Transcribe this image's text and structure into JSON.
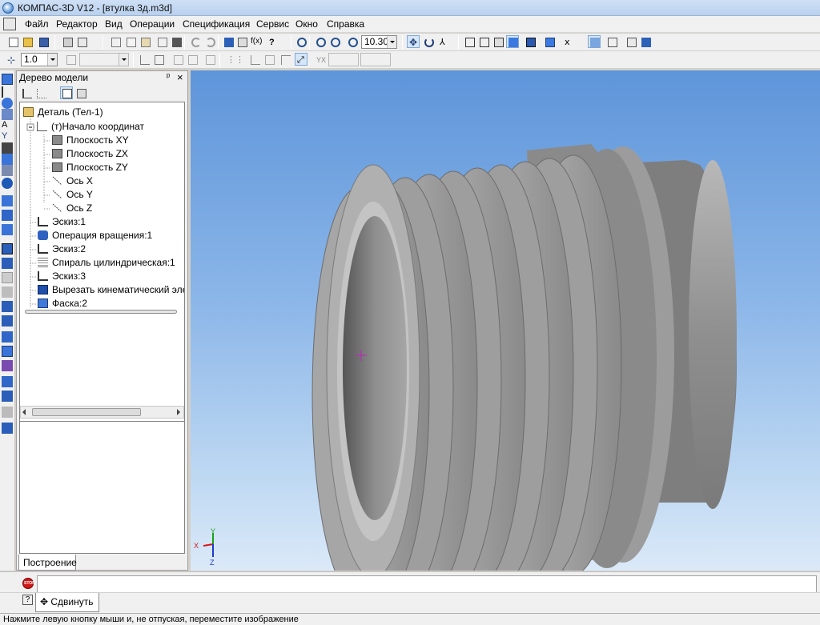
{
  "window": {
    "title": "КОМПАС-3D V12 - [втулка 3д.m3d]"
  },
  "menu": [
    "Файл",
    "Редактор",
    "Вид",
    "Операции",
    "Спецификация",
    "Сервис",
    "Окно",
    "Справка"
  ],
  "toolbar": {
    "zoom_value": "10.30",
    "line_step_value": "1.0"
  },
  "tree": {
    "title": "Дерево модели",
    "pin": "ᵖ",
    "close": "×",
    "items": [
      {
        "label": "Деталь (Тел-1)",
        "icon": "part-icon"
      },
      {
        "label": "(т)Начало координат",
        "icon": "origin-icon"
      },
      {
        "label": "Плоскость XY",
        "icon": "plane-icon"
      },
      {
        "label": "Плоскость ZX",
        "icon": "plane-icon"
      },
      {
        "label": "Плоскость ZY",
        "icon": "plane-icon"
      },
      {
        "label": "Ось X",
        "icon": "axis-icon"
      },
      {
        "label": "Ось Y",
        "icon": "axis-icon"
      },
      {
        "label": "Ось Z",
        "icon": "axis-icon"
      },
      {
        "label": "Эскиз:1",
        "icon": "sketch-icon"
      },
      {
        "label": "Операция вращения:1",
        "icon": "revolve-icon"
      },
      {
        "label": "Эскиз:2",
        "icon": "sketch-icon"
      },
      {
        "label": "Спираль цилиндрическая:1",
        "icon": "helix-icon"
      },
      {
        "label": "Эскиз:3",
        "icon": "sketch-icon"
      },
      {
        "label": "Вырезать кинематический эле",
        "icon": "sweep-cut-icon"
      },
      {
        "label": "Фаска:2",
        "icon": "chamfer-icon"
      }
    ],
    "tab_label": "Построение"
  },
  "axes": {
    "x": "X",
    "y": "Y",
    "z": "Z"
  },
  "command": {
    "stop_label": "STOP",
    "help_label": "?",
    "move_label": "Сдвинуть"
  },
  "status": {
    "text": "Нажмите левую кнопку мыши и, не отпуская, переместите изображение"
  },
  "colors": {
    "viewport_top": "#5e95da",
    "viewport_bottom": "#dbe9f8",
    "part": "#8f8f8f"
  }
}
